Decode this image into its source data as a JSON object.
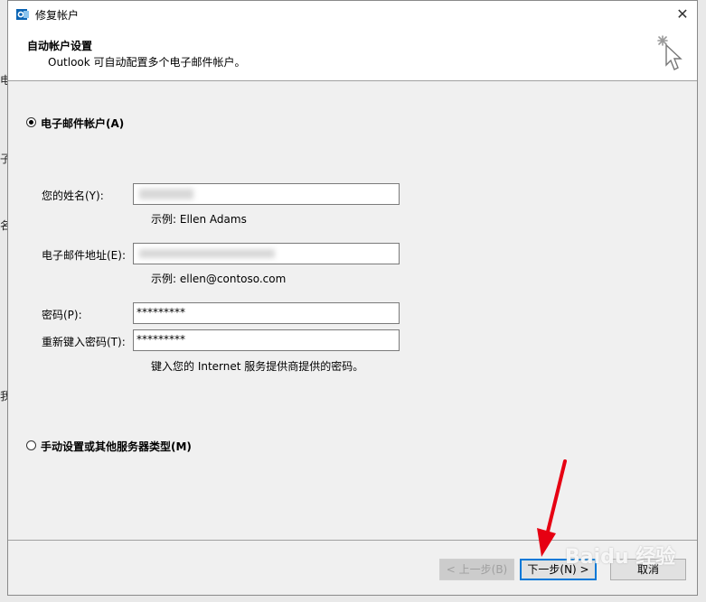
{
  "window": {
    "title": "修复帐户",
    "close_glyph": "✕"
  },
  "header": {
    "title": "自动帐户设置",
    "subtitle": "Outlook 可自动配置多个电子邮件帐户。"
  },
  "options": {
    "email_account_label": "电子邮件帐户(A)",
    "email_account_selected": true,
    "manual_label": "手动设置或其他服务器类型(M)",
    "manual_selected": false
  },
  "form": {
    "name_label": "您的姓名(Y):",
    "name_value": "",
    "name_hint": "示例: Ellen Adams",
    "email_label": "电子邮件地址(E):",
    "email_value": "",
    "email_hint": "示例: ellen@contoso.com",
    "password_label": "密码(P):",
    "password_value": "*********",
    "retype_label": "重新键入密码(T):",
    "retype_value": "*********",
    "password_hint": "键入您的 Internet 服务提供商提供的密码。"
  },
  "buttons": {
    "back": "< 上一步(B)",
    "next": "下一步(N) >",
    "cancel": "取消"
  },
  "watermark": "Baidu 经验",
  "background_fragments": [
    "电",
    "子",
    "名",
    "我"
  ],
  "colors": {
    "accent": "#0078d7",
    "arrow": "#e60012"
  }
}
